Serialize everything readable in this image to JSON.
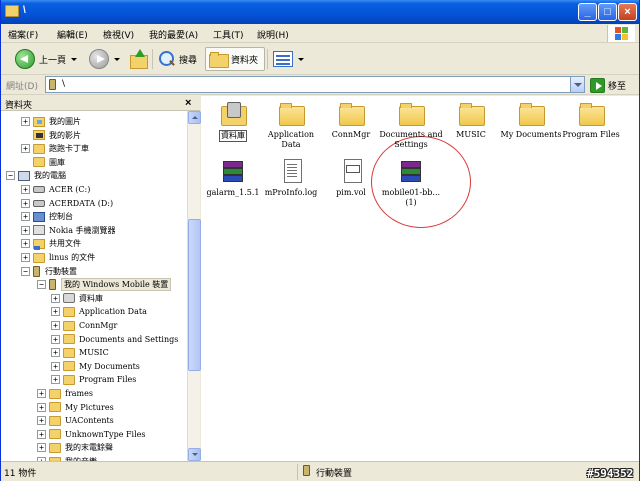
{
  "window": {
    "title": "\\"
  },
  "title_buttons": {
    "minimize": "_",
    "maximize": "□",
    "close": "×"
  },
  "menu": [
    {
      "label": "檔案(F)"
    },
    {
      "label": "編輯(E)"
    },
    {
      "label": "檢視(V)"
    },
    {
      "label": "我的最愛(A)"
    },
    {
      "label": "工具(T)"
    },
    {
      "label": "說明(H)"
    }
  ],
  "toolbar": {
    "back_label": "上一頁",
    "search_label": "搜尋",
    "folders_label": "資料夾"
  },
  "address": {
    "label": "網址(D)",
    "value": "\\",
    "go_label": "移至"
  },
  "folder_pane": {
    "title": "資料夾",
    "close": "×"
  },
  "tree": [
    {
      "label": "我的圖片",
      "toggle": "+",
      "icon": "pictures"
    },
    {
      "label": "我的影片",
      "toggle": "",
      "icon": "videos"
    },
    {
      "label": "跑跑卡丁車",
      "toggle": "+",
      "icon": "folder"
    },
    {
      "label": "圖庫",
      "toggle": "",
      "icon": "folder"
    },
    {
      "label": "我的電腦",
      "toggle": "−",
      "icon": "computer"
    },
    {
      "label": "ACER (C:)",
      "toggle": "+",
      "icon": "drive"
    },
    {
      "label": "ACERDATA (D:)",
      "toggle": "+",
      "icon": "drive"
    },
    {
      "label": "控制台",
      "toggle": "+",
      "icon": "control"
    },
    {
      "label": "Nokia 手機瀏覽器",
      "toggle": "+",
      "icon": "card"
    },
    {
      "label": "共用文件",
      "toggle": "+",
      "icon": "share"
    },
    {
      "label": "linus 的文件",
      "toggle": "+",
      "icon": "folder"
    },
    {
      "label": "行動裝置",
      "toggle": "−",
      "icon": "phone"
    },
    {
      "label": "我的 Windows Mobile 裝置",
      "toggle": "−",
      "icon": "phone",
      "selected": true
    },
    {
      "label": "資料庫",
      "toggle": "+",
      "icon": "db"
    },
    {
      "label": "Application Data",
      "toggle": "+",
      "icon": "folder"
    },
    {
      "label": "ConnMgr",
      "toggle": "+",
      "icon": "folder"
    },
    {
      "label": "Documents and Settings",
      "toggle": "+",
      "icon": "folder"
    },
    {
      "label": "MUSIC",
      "toggle": "+",
      "icon": "folder"
    },
    {
      "label": "My Documents",
      "toggle": "+",
      "icon": "folder"
    },
    {
      "label": "Program Files",
      "toggle": "+",
      "icon": "folder"
    },
    {
      "label": "frames",
      "toggle": "+",
      "icon": "folder"
    },
    {
      "label": "My Pictures",
      "toggle": "+",
      "icon": "folder"
    },
    {
      "label": "UAContents",
      "toggle": "+",
      "icon": "folder"
    },
    {
      "label": "UnknownType Files",
      "toggle": "+",
      "icon": "folder"
    },
    {
      "label": "我的末電餘聲",
      "toggle": "+",
      "icon": "folder"
    },
    {
      "label": "我的音樂",
      "toggle": "+",
      "icon": "folder"
    }
  ],
  "files": [
    {
      "label": "資料庫",
      "icon": "db-icon"
    },
    {
      "label": "Application Data",
      "icon": "folder-icon"
    },
    {
      "label": "ConnMgr",
      "icon": "folder-icon"
    },
    {
      "label": "Documents and Settings",
      "icon": "folder-icon"
    },
    {
      "label": "MUSIC",
      "icon": "folder-icon"
    },
    {
      "label": "My Documents",
      "icon": "folder-icon"
    },
    {
      "label": "Program Files",
      "icon": "folder-icon"
    },
    {
      "label": "galarm_1.5.1",
      "icon": "rar-archive-icon"
    },
    {
      "label": "mProInfo.log",
      "icon": "text-document-icon"
    },
    {
      "label": "pim.vol",
      "icon": "vol-file-icon"
    },
    {
      "label": "mobile01-bb... (1)",
      "icon": "rar-archive-icon"
    }
  ],
  "status": {
    "count": "11 物件",
    "location": "行動裝置",
    "watermark": "#594352"
  },
  "colors": {
    "titlebar": "#0453d8",
    "highlight_circle": "#d83a3a",
    "xp_face": "#ece9d8"
  }
}
